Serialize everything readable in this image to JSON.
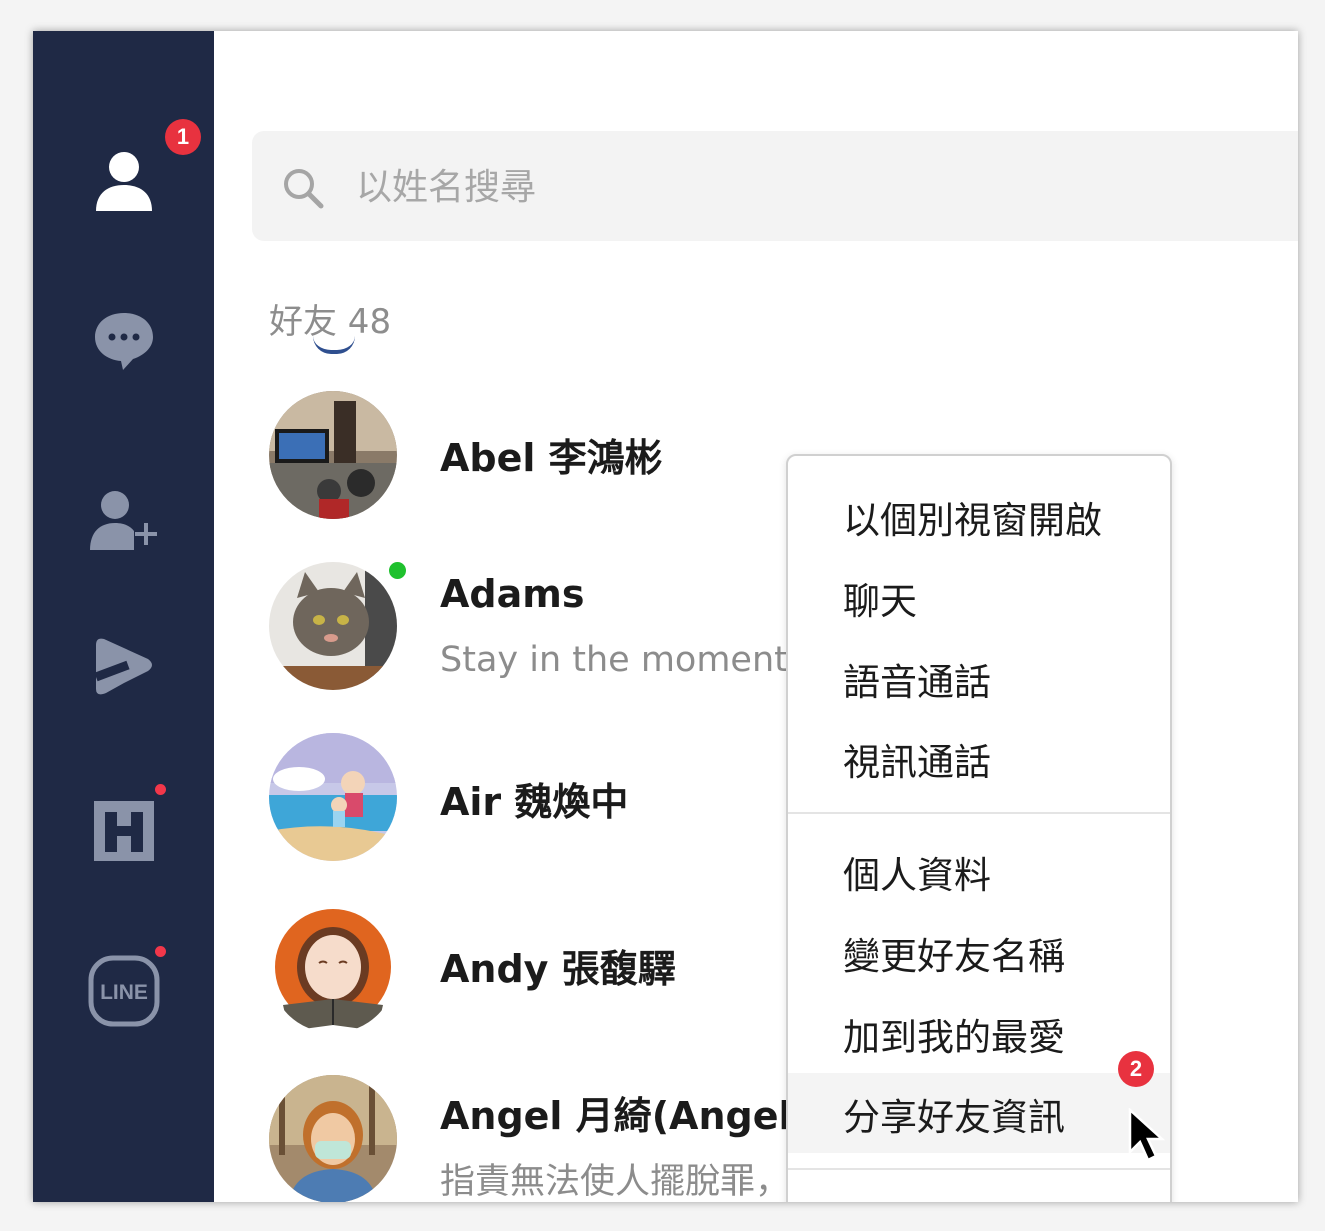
{
  "sidebar": {
    "items": [
      {
        "id": "friends",
        "icon": "person-icon",
        "active": true
      },
      {
        "id": "chats",
        "icon": "chat-bubble-icon"
      },
      {
        "id": "add-friends",
        "icon": "add-person-icon"
      },
      {
        "id": "today",
        "icon": "play-icon"
      },
      {
        "id": "hub",
        "icon": "h-logo-icon"
      },
      {
        "id": "line",
        "icon": "line-logo-icon",
        "label": "LINE"
      }
    ]
  },
  "callouts": {
    "first": "1",
    "second": "2"
  },
  "search": {
    "placeholder": "以姓名搜尋"
  },
  "friends_header": "好友 48",
  "friends": [
    {
      "name": "Abel 李鴻彬",
      "status": "",
      "online": false
    },
    {
      "name": "Adams",
      "status": "Stay in the moment",
      "online": true
    },
    {
      "name": "Air 魏煥中",
      "status": "",
      "online": false
    },
    {
      "name": "Andy 張馥驛",
      "status": "",
      "online": false
    },
    {
      "name": "Angel 月綺(Angel)",
      "status": "指責無法使人擺脫罪，",
      "online": false
    }
  ],
  "context_menu": {
    "group1": [
      "以個別視窗開啟",
      "聊天",
      "語音通話",
      "視訊通話"
    ],
    "group2": [
      "個人資料",
      "變更好友名稱",
      "加到我的最愛",
      "分享好友資訊"
    ]
  },
  "colors": {
    "sidebar_bg": "#1f2945",
    "callout": "#e8323f",
    "online": "#1fc12e"
  }
}
